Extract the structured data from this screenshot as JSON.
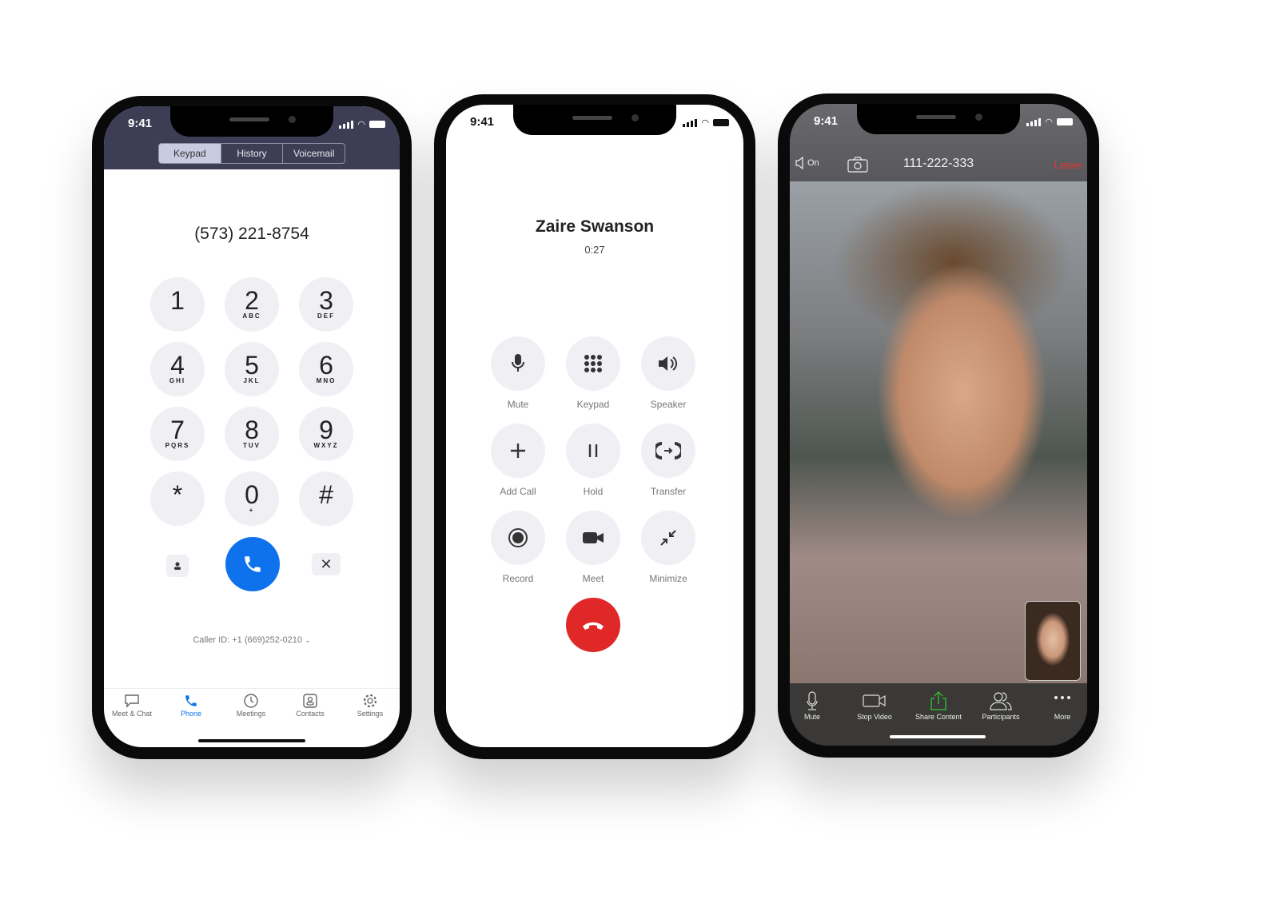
{
  "status": {
    "time": "9:41"
  },
  "dialer": {
    "tabs": [
      "Keypad",
      "History",
      "Voicemail"
    ],
    "active_tab": "Keypad",
    "number": "(573) 221-8754",
    "keys": [
      {
        "d": "1",
        "l": ""
      },
      {
        "d": "2",
        "l": "ABC"
      },
      {
        "d": "3",
        "l": "DEF"
      },
      {
        "d": "4",
        "l": "GHI"
      },
      {
        "d": "5",
        "l": "JKL"
      },
      {
        "d": "6",
        "l": "MNO"
      },
      {
        "d": "7",
        "l": "PQRS"
      },
      {
        "d": "8",
        "l": "TUV"
      },
      {
        "d": "9",
        "l": "WXYZ"
      },
      {
        "d": "*",
        "l": ""
      },
      {
        "d": "0",
        "l": "+"
      },
      {
        "d": "#",
        "l": ""
      }
    ],
    "caller_id": "Caller ID: +1 (669)252-0210",
    "nav": [
      "Meet & Chat",
      "Phone",
      "Meetings",
      "Contacts",
      "Settings"
    ],
    "active_nav": "Phone",
    "accent": "#0e72ed"
  },
  "call": {
    "name": "Zaire Swanson",
    "duration": "0:27",
    "buttons": [
      {
        "label": "Mute",
        "icon": "microphone-icon"
      },
      {
        "label": "Keypad",
        "icon": "keypad-icon"
      },
      {
        "label": "Speaker",
        "icon": "speaker-icon"
      },
      {
        "label": "Add Call",
        "icon": "plus-icon"
      },
      {
        "label": "Hold",
        "icon": "pause-icon"
      },
      {
        "label": "Transfer",
        "icon": "transfer-icon"
      },
      {
        "label": "Record",
        "icon": "record-icon"
      },
      {
        "label": "Meet",
        "icon": "video-camera-icon"
      },
      {
        "label": "Minimize",
        "icon": "minimize-icon"
      }
    ],
    "end_color": "#e02828"
  },
  "meeting": {
    "audio": "On",
    "meeting_id": "111-222-333",
    "leave": "Leave",
    "toolbar": [
      "Mute",
      "Stop Video",
      "Share Content",
      "Participants",
      "More"
    ],
    "share_color": "#35b12e",
    "leave_color": "#e5352f"
  }
}
